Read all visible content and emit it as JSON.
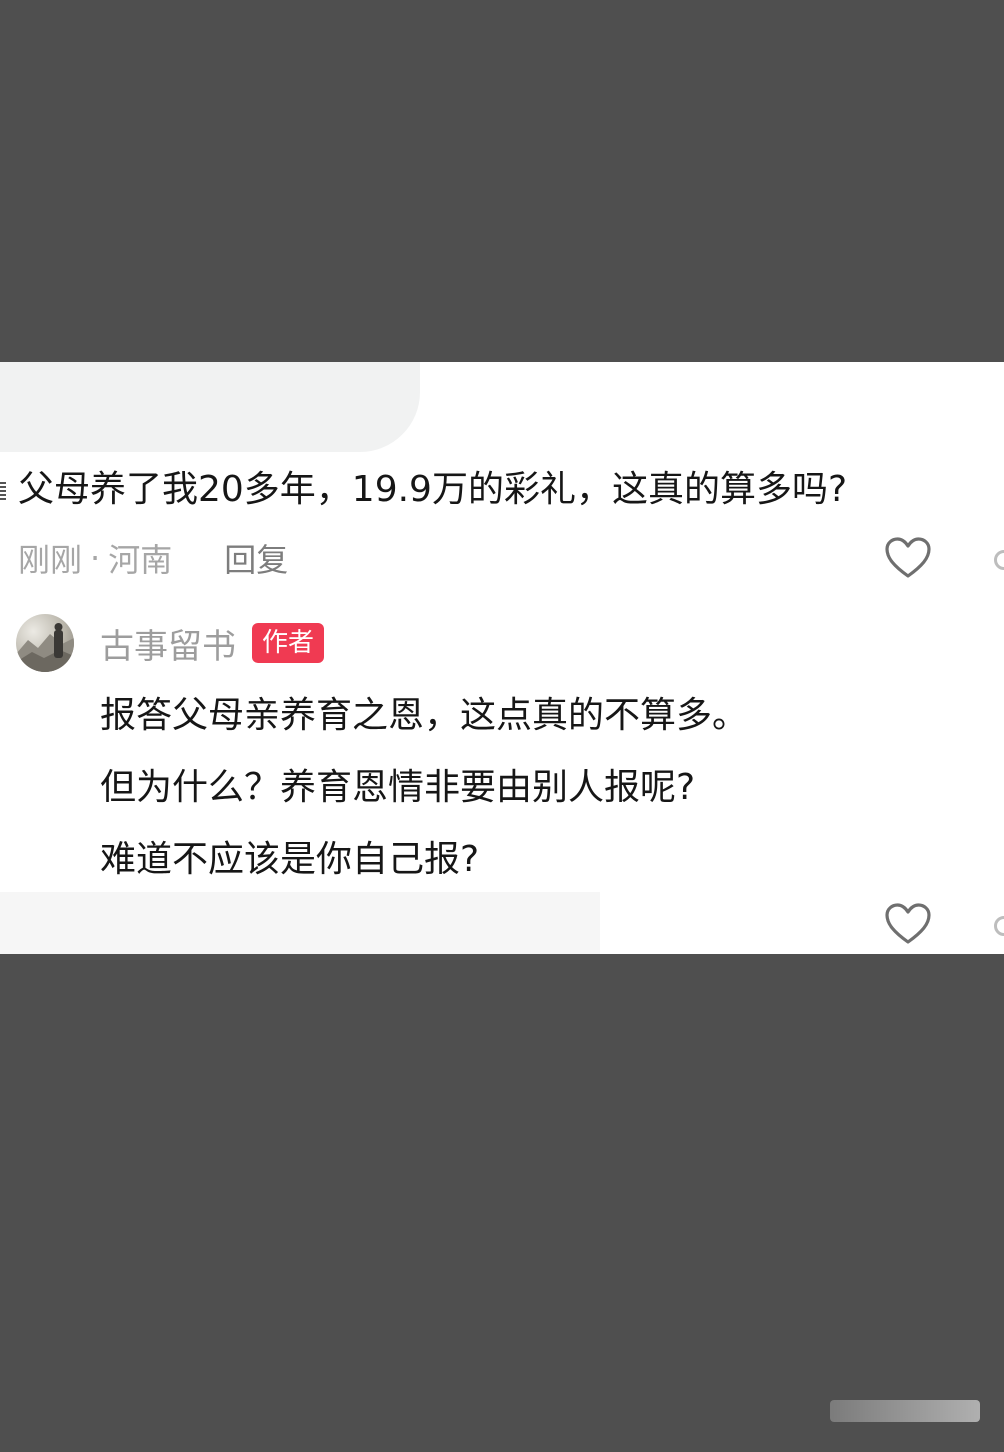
{
  "comment": {
    "text": "父母养了我20多年，19.9万的彩礼，这真的算多吗?",
    "time": "刚刚",
    "separator": "·",
    "location": "河南",
    "reply_label": "回复"
  },
  "reply": {
    "author": "古事留书",
    "badge": "作者",
    "lines": [
      "报答父母亲养育之恩，这点真的不算多。",
      "但为什么？养育恩情非要由别人报呢?",
      "难道不应该是你自己报?"
    ]
  },
  "icons": {
    "like": "heart-outline-icon"
  },
  "colors": {
    "background": "#4f4f4f",
    "card": "#ffffff",
    "badge": "#f03a52",
    "meta": "#a6a6a6"
  }
}
